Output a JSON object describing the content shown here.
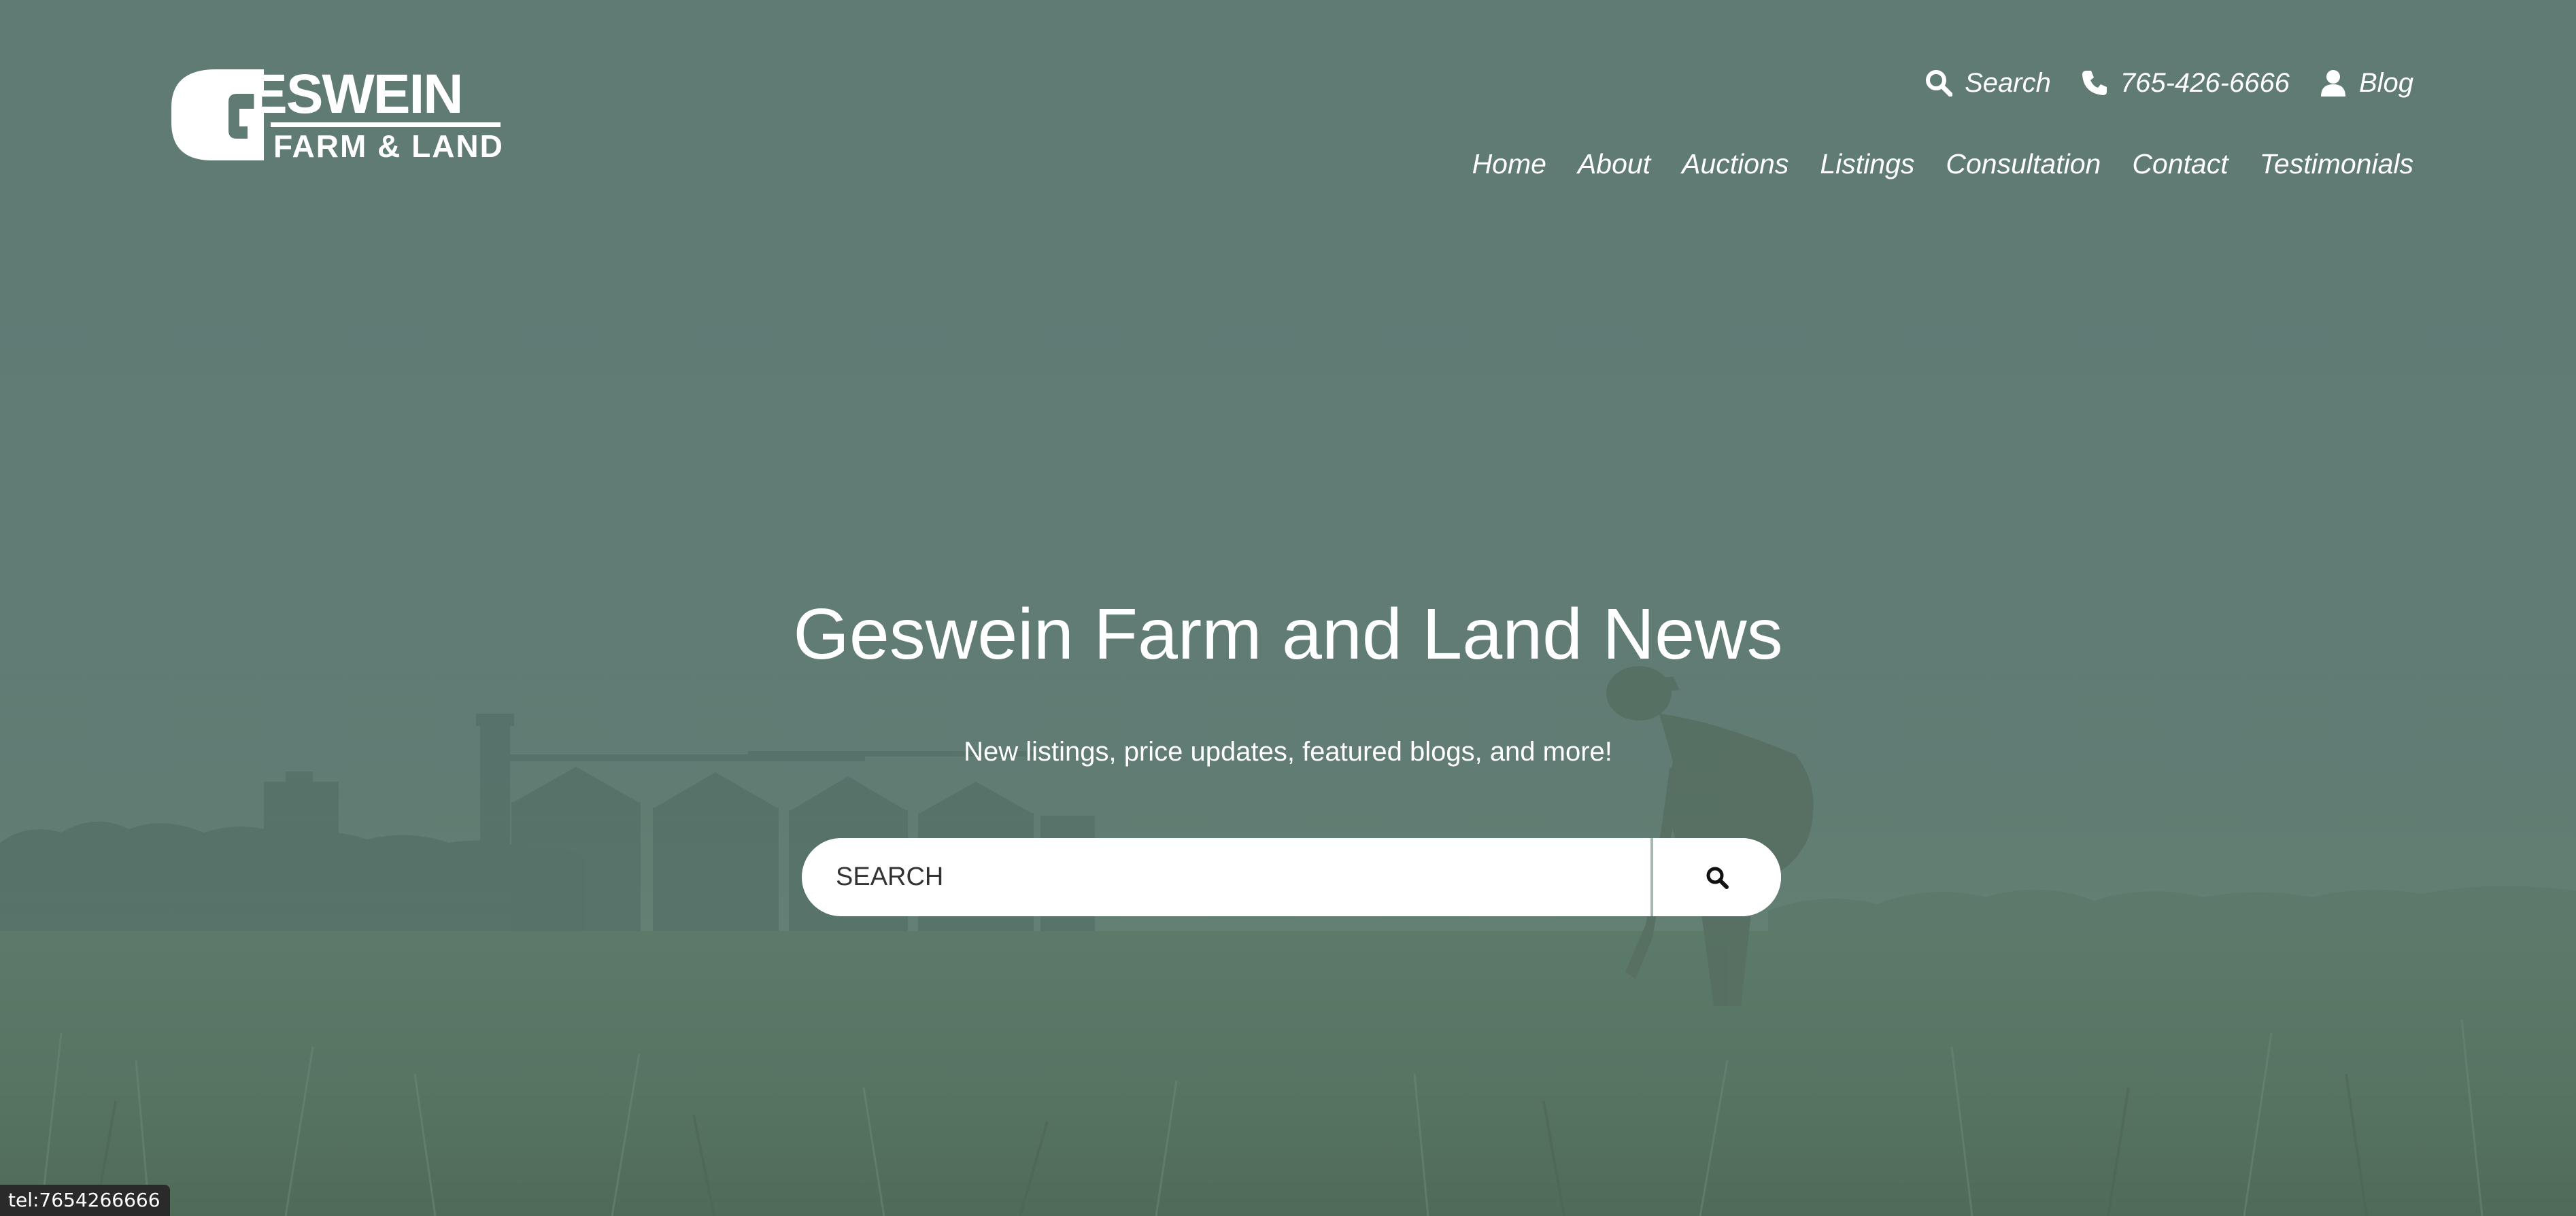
{
  "brand": {
    "logo_top": "ESWEIN",
    "logo_letter": "G",
    "logo_bottom": "FARM & LAND",
    "logo_color": "#ffffff"
  },
  "utility_nav": {
    "search": {
      "label": "Search",
      "icon": "search-icon"
    },
    "phone": {
      "label": "765-426-6666",
      "icon": "phone-icon"
    },
    "blog": {
      "label": "Blog",
      "icon": "user-icon"
    }
  },
  "main_nav": {
    "items": [
      {
        "label": "Home"
      },
      {
        "label": "About"
      },
      {
        "label": "Auctions"
      },
      {
        "label": "Listings"
      },
      {
        "label": "Consultation"
      },
      {
        "label": "Contact"
      },
      {
        "label": "Testimonials"
      }
    ]
  },
  "hero": {
    "title": "Geswein Farm and Land News",
    "subtitle": "New listings, price updates, featured blogs, and more!",
    "search_placeholder": "SEARCH",
    "search_button_icon": "search-icon"
  },
  "status_bar": {
    "link_preview": "tel:7654266666"
  },
  "colors": {
    "overlay": "#607a74",
    "text": "#ffffff",
    "search_bg": "#ffffff"
  }
}
